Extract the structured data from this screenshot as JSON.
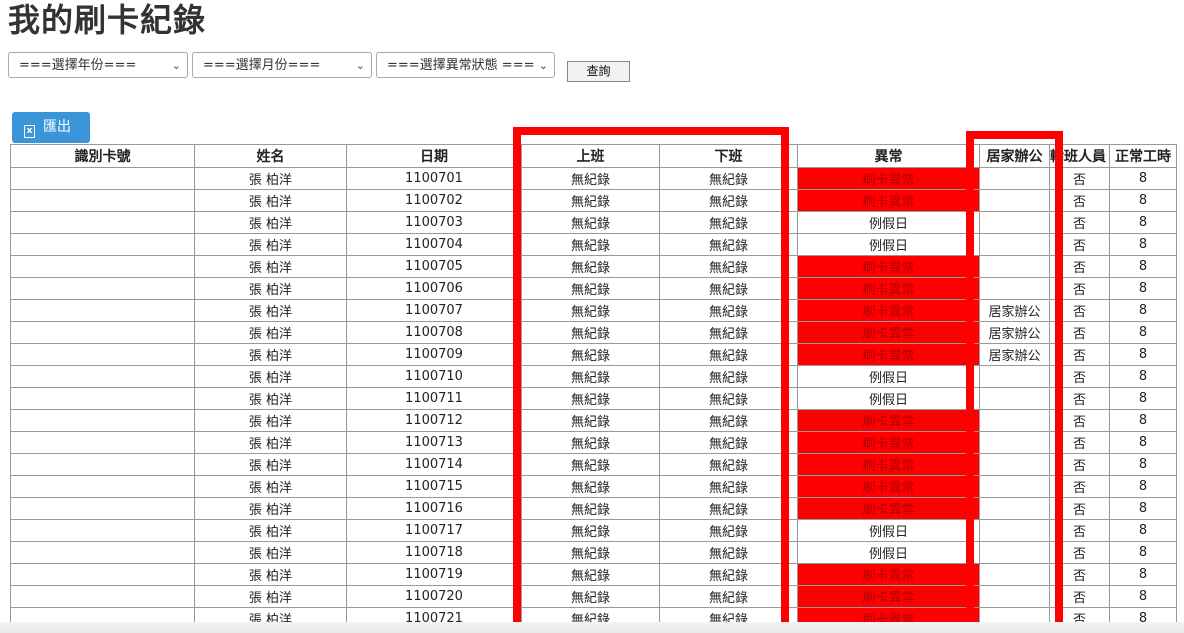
{
  "page": {
    "title": "我的刷卡紀錄"
  },
  "filters": {
    "year": "===選擇年份===",
    "month": "===選擇月份===",
    "status": "===選擇異常狀態 ===",
    "query_label": "查詢"
  },
  "toolbar": {
    "export_label": "匯出"
  },
  "table": {
    "headers": [
      "識別卡號",
      "姓名",
      "日期",
      "上班",
      "下班",
      "異常",
      "居家辦公",
      "輪班人員",
      "正常工時"
    ],
    "rows": [
      {
        "card": "",
        "name": "張 柏洋",
        "date": "1100701",
        "in": "無紀錄",
        "out": "無紀錄",
        "anomaly": "刷卡異常",
        "home": "",
        "shift": "否",
        "hours": "8"
      },
      {
        "card": "",
        "name": "張 柏洋",
        "date": "1100702",
        "in": "無紀錄",
        "out": "無紀錄",
        "anomaly": "刷卡異常",
        "home": "",
        "shift": "否",
        "hours": "8"
      },
      {
        "card": "",
        "name": "張 柏洋",
        "date": "1100703",
        "in": "無紀錄",
        "out": "無紀錄",
        "anomaly": "例假日",
        "home": "",
        "shift": "否",
        "hours": "8"
      },
      {
        "card": "",
        "name": "張 柏洋",
        "date": "1100704",
        "in": "無紀錄",
        "out": "無紀錄",
        "anomaly": "例假日",
        "home": "",
        "shift": "否",
        "hours": "8"
      },
      {
        "card": "",
        "name": "張 柏洋",
        "date": "1100705",
        "in": "無紀錄",
        "out": "無紀錄",
        "anomaly": "刷卡異常",
        "home": "",
        "shift": "否",
        "hours": "8"
      },
      {
        "card": "",
        "name": "張 柏洋",
        "date": "1100706",
        "in": "無紀錄",
        "out": "無紀錄",
        "anomaly": "刷卡異常",
        "home": "",
        "shift": "否",
        "hours": "8"
      },
      {
        "card": "",
        "name": "張 柏洋",
        "date": "1100707",
        "in": "無紀錄",
        "out": "無紀錄",
        "anomaly": "刷卡異常",
        "home": "居家辦公",
        "shift": "否",
        "hours": "8"
      },
      {
        "card": "",
        "name": "張 柏洋",
        "date": "1100708",
        "in": "無紀錄",
        "out": "無紀錄",
        "anomaly": "刷卡異常",
        "home": "居家辦公",
        "shift": "否",
        "hours": "8"
      },
      {
        "card": "",
        "name": "張 柏洋",
        "date": "1100709",
        "in": "無紀錄",
        "out": "無紀錄",
        "anomaly": "刷卡異常",
        "home": "居家辦公",
        "shift": "否",
        "hours": "8"
      },
      {
        "card": "",
        "name": "張 柏洋",
        "date": "1100710",
        "in": "無紀錄",
        "out": "無紀錄",
        "anomaly": "例假日",
        "home": "",
        "shift": "否",
        "hours": "8"
      },
      {
        "card": "",
        "name": "張 柏洋",
        "date": "1100711",
        "in": "無紀錄",
        "out": "無紀錄",
        "anomaly": "例假日",
        "home": "",
        "shift": "否",
        "hours": "8"
      },
      {
        "card": "",
        "name": "張 柏洋",
        "date": "1100712",
        "in": "無紀錄",
        "out": "無紀錄",
        "anomaly": "刷卡異常",
        "home": "",
        "shift": "否",
        "hours": "8"
      },
      {
        "card": "",
        "name": "張 柏洋",
        "date": "1100713",
        "in": "無紀錄",
        "out": "無紀錄",
        "anomaly": "刷卡異常",
        "home": "",
        "shift": "否",
        "hours": "8"
      },
      {
        "card": "",
        "name": "張 柏洋",
        "date": "1100714",
        "in": "無紀錄",
        "out": "無紀錄",
        "anomaly": "刷卡異常",
        "home": "",
        "shift": "否",
        "hours": "8"
      },
      {
        "card": "",
        "name": "張 柏洋",
        "date": "1100715",
        "in": "無紀錄",
        "out": "無紀錄",
        "anomaly": "刷卡異常",
        "home": "",
        "shift": "否",
        "hours": "8"
      },
      {
        "card": "",
        "name": "張 柏洋",
        "date": "1100716",
        "in": "無紀錄",
        "out": "無紀錄",
        "anomaly": "刷卡異常",
        "home": "",
        "shift": "否",
        "hours": "8"
      },
      {
        "card": "",
        "name": "張 柏洋",
        "date": "1100717",
        "in": "無紀錄",
        "out": "無紀錄",
        "anomaly": "例假日",
        "home": "",
        "shift": "否",
        "hours": "8"
      },
      {
        "card": "",
        "name": "張 柏洋",
        "date": "1100718",
        "in": "無紀錄",
        "out": "無紀錄",
        "anomaly": "例假日",
        "home": "",
        "shift": "否",
        "hours": "8"
      },
      {
        "card": "",
        "name": "張 柏洋",
        "date": "1100719",
        "in": "無紀錄",
        "out": "無紀錄",
        "anomaly": "刷卡異常",
        "home": "",
        "shift": "否",
        "hours": "8"
      },
      {
        "card": "",
        "name": "張 柏洋",
        "date": "1100720",
        "in": "無紀錄",
        "out": "無紀錄",
        "anomaly": "刷卡異常",
        "home": "",
        "shift": "否",
        "hours": "8"
      },
      {
        "card": "",
        "name": "張 柏洋",
        "date": "1100721",
        "in": "無紀錄",
        "out": "無紀錄",
        "anomaly": "刷卡異常",
        "home": "",
        "shift": "否",
        "hours": "8"
      }
    ]
  },
  "colors": {
    "error_fill": "#ff0000",
    "accent": "#3a96d8",
    "highlight": "#ff0000"
  }
}
